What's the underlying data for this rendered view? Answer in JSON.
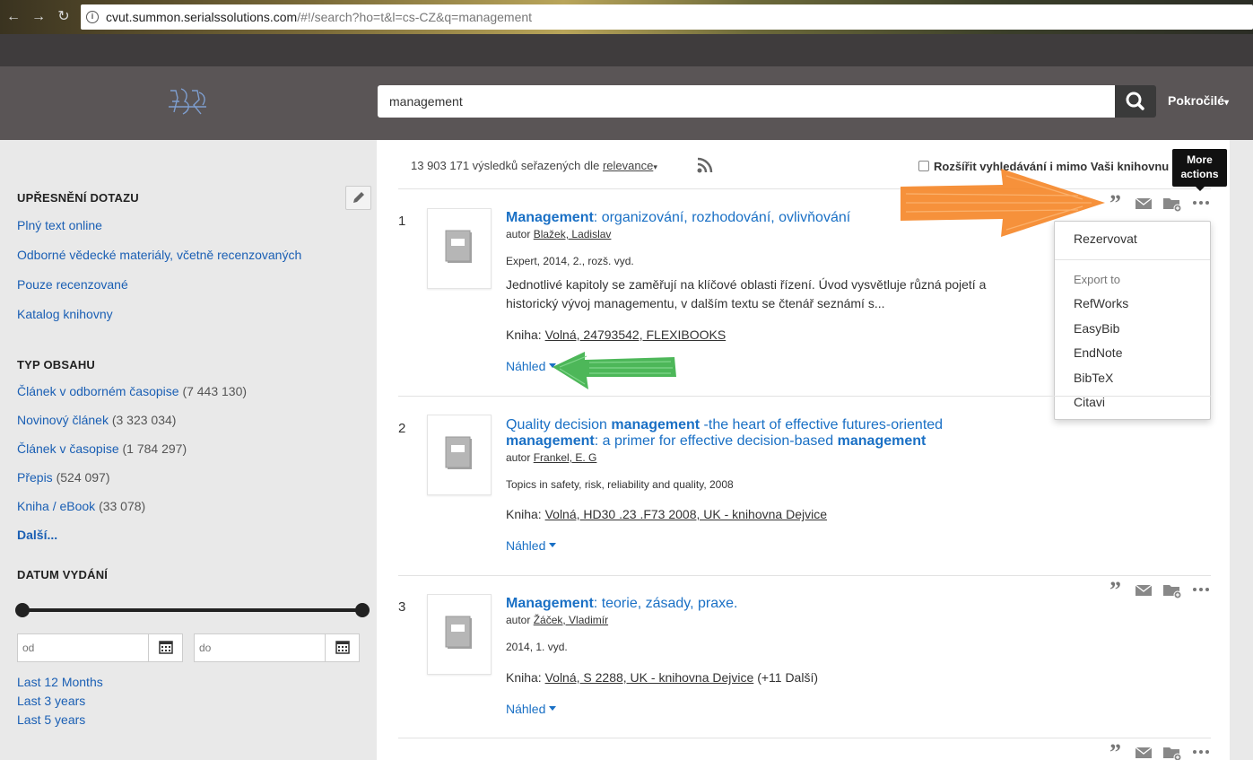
{
  "browser": {
    "url_host": "cvut.summon.serialssolutions.com",
    "url_rest": "/#!/search?ho=t&l=cs-CZ&q=management"
  },
  "search": {
    "query": "management",
    "advanced_label": "Pokročilé"
  },
  "sidebar": {
    "refine_heading": "UPŘESNĚNÍ DOTAZU",
    "refine_links": [
      "Plný text online",
      "Odborné vědecké materiály, včetně recenzovaných",
      "Pouze recenzované",
      "Katalog knihovny"
    ],
    "content_type_heading": "TYP OBSAHU",
    "content_types": [
      {
        "label": "Článek v odborném časopise",
        "count": "(7 443 130)"
      },
      {
        "label": "Novinový článek",
        "count": "(3 323 034)"
      },
      {
        "label": "Článek v časopise",
        "count": "(1 784 297)"
      },
      {
        "label": "Přepis",
        "count": "(524 097)"
      },
      {
        "label": "Kniha / eBook",
        "count": "(33 078)"
      }
    ],
    "more_label": "Další...",
    "date_heading": "DATUM VYDÁNÍ",
    "date_from_placeholder": "od",
    "date_to_placeholder": "do",
    "quick_dates": [
      "Last 12 Months",
      "Last 3 years",
      "Last 5 years"
    ]
  },
  "results_header": {
    "count_text": "13 903 171 výsledků seřazených dle",
    "sort_label": "relevance",
    "expand_label": "Rozšířit vyhledávání i mimo Vaši knihovnu"
  },
  "tooltip": {
    "line1": "More",
    "line2": "actions"
  },
  "menu": {
    "reserve": "Rezervovat",
    "export_heading": "Export to",
    "export_items": [
      "RefWorks",
      "EasyBib",
      "EndNote",
      "BibTeX",
      "Citavi"
    ]
  },
  "results": [
    {
      "number": "1",
      "title_bold": "Management",
      "title_rest": ": organizování, rozhodování, ovlivňování",
      "author_prefix": "autor",
      "author": "Blažek, Ladislav",
      "meta": "Expert, 2014, 2., rozš. vyd.",
      "description": "Jednotlivé kapitoly se zaměřují na klíčové oblasti řízení. Úvod vysvětluje různá pojetí a historický vývoj managementu, v dalším textu se čtenář seznámí s...",
      "avail_prefix": "Kniha:",
      "avail": "Volná, 24793542, FLEXIBOOKS",
      "avail_extra": "",
      "preview": "Náhled"
    },
    {
      "number": "2",
      "title_p1": "Quality decision ",
      "title_b1": "management",
      "title_p2": " -the heart of effective futures-oriented",
      "title_b2": "management",
      "title_p3": ": a primer for effective decision-based ",
      "title_b3": "management",
      "author_prefix": "autor",
      "author": "Frankel, E. G",
      "meta": "Topics in safety, risk, reliability and quality, 2008",
      "avail_prefix": "Kniha:",
      "avail": "Volná, HD30 .23 .F73 2008, UK - knihovna Dejvice",
      "preview": "Náhled"
    },
    {
      "number": "3",
      "title_bold": "Management",
      "title_rest": ": teorie, zásady, praxe.",
      "author_prefix": "autor",
      "author": "Žáček, Vladimír",
      "meta": "2014, 1. vyd.",
      "avail_prefix": "Kniha:",
      "avail": "Volná, S 2288, UK - knihovna Dejvice",
      "avail_extra": "(+11 Další)",
      "preview": "Náhled"
    }
  ],
  "colors": {
    "link": "#1a5fb4",
    "title": "#1a70c5",
    "header": "#5a5556",
    "orange_arrow": "#f58220",
    "green_arrow": "#2eaa3c"
  }
}
